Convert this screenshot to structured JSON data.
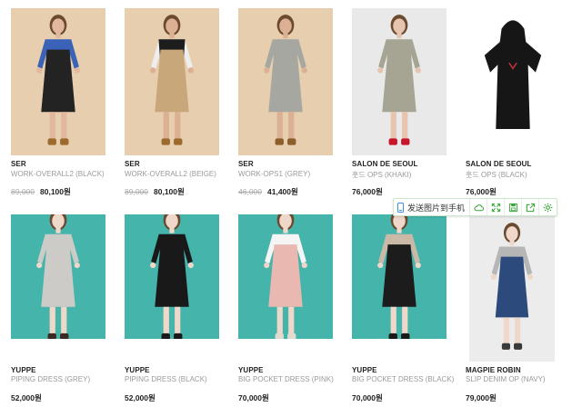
{
  "products": [
    {
      "brand": "SER",
      "name": "WORK-OVERALL2 (BLACK)",
      "old_price": "89,000",
      "price": "80,100원",
      "bg": "#e6ceae",
      "dress": "#232323",
      "top": "#3a62b8",
      "sleeve": "#3a62b8",
      "legs": "#e2b79f",
      "shoes": "#9b6a2c",
      "image": "model-overall-black"
    },
    {
      "brand": "SER",
      "name": "WORK-OVERALL2 (BEIGE)",
      "old_price": "89,000",
      "price": "80,100원",
      "bg": "#e6ceae",
      "dress": "#c8a77a",
      "top": "#1d1d1d",
      "sleeve": "#eeeeee",
      "legs": "#dbb093",
      "shoes": "#9b6a2c",
      "image": "model-overall-beige"
    },
    {
      "brand": "SER",
      "name": "WORK-OPS1 (GREY)",
      "old_price": "46,000",
      "price": "41,400원",
      "bg": "#e6ceae",
      "dress": "#a7a7a2",
      "top": "#a7a7a2",
      "sleeve": "#a7a7a2",
      "legs": "#dbb093",
      "shoes": "#8b5e2a",
      "image": "model-ops-grey"
    },
    {
      "brand": "SALON DE SEOUL",
      "name": "훗드 OPS (KHAKI)",
      "old_price": "",
      "price": "76,000원",
      "bg": "#e9e9ea",
      "dress": "#a6a594",
      "top": "#a6a594",
      "sleeve": "#a6a594",
      "legs": "#e7c4ae",
      "shoes": "#c7152a",
      "image": "model-hood-khaki"
    },
    {
      "brand": "SALON DE SEOUL",
      "name": "훗드 OPS (BLACK)",
      "old_price": "",
      "price": "76,000원",
      "bg": "#ffffff",
      "dress": "#161616",
      "top": "#161616",
      "sleeve": "#161616",
      "legs": "#ffffff",
      "shoes": "#ffffff",
      "image": "hood-dress-black"
    },
    {
      "brand": "YUPPE",
      "name": "PIPING DRESS (GREY)",
      "old_price": "",
      "price": "52,000원",
      "bg": "#45b4ab",
      "dress": "#cdcbc7",
      "top": "#cdcbc7",
      "sleeve": "#cdcbc7",
      "legs": "#efd7c9",
      "shoes": "#3c2a22",
      "image": "model-piping-grey"
    },
    {
      "brand": "YUPPE",
      "name": "PIPING DRESS (BLACK)",
      "old_price": "",
      "price": "52,000원",
      "bg": "#45b4ab",
      "dress": "#191919",
      "top": "#191919",
      "sleeve": "#191919",
      "legs": "#efd7c9",
      "shoes": "#1a1a1a",
      "image": "model-piping-black"
    },
    {
      "brand": "YUPPE",
      "name": "BIG POCKET DRESS (PINK)",
      "old_price": "",
      "price": "70,000원",
      "bg": "#45b4ab",
      "dress": "#e9b8b0",
      "top": "#f5f5f5",
      "sleeve": "#f5f5f5",
      "legs": "#efd7c9",
      "shoes": "#e2d9cf",
      "image": "model-pocket-pink"
    },
    {
      "brand": "YUPPE",
      "name": "BIG POCKET DRESS (BLACK)",
      "old_price": "",
      "price": "70,000원",
      "bg": "#45b4ab",
      "dress": "#1c1c1c",
      "top": "#c9b9a6",
      "sleeve": "#c9b9a6",
      "legs": "#efd7c9",
      "shoes": "#1a1a1a",
      "image": "model-pocket-black"
    },
    {
      "brand": "MAGPIE ROBIN",
      "name": "SLIP DENIM OP (NAVY)",
      "old_price": "",
      "price": "79,000원",
      "bg": "#ececec",
      "dress": "#2c4a7b",
      "top": "#b6b6b6",
      "sleeve": "#b6b6b6",
      "legs": "#efd7c9",
      "shoes": "#3a3a3a",
      "image": "model-slip-denim"
    }
  ],
  "toolbar": {
    "send_label": "发送图片到手机",
    "icons": [
      "cloud-icon",
      "expand-icon",
      "save-icon",
      "share-icon",
      "settings-icon"
    ],
    "accent": "#3aa53a"
  }
}
